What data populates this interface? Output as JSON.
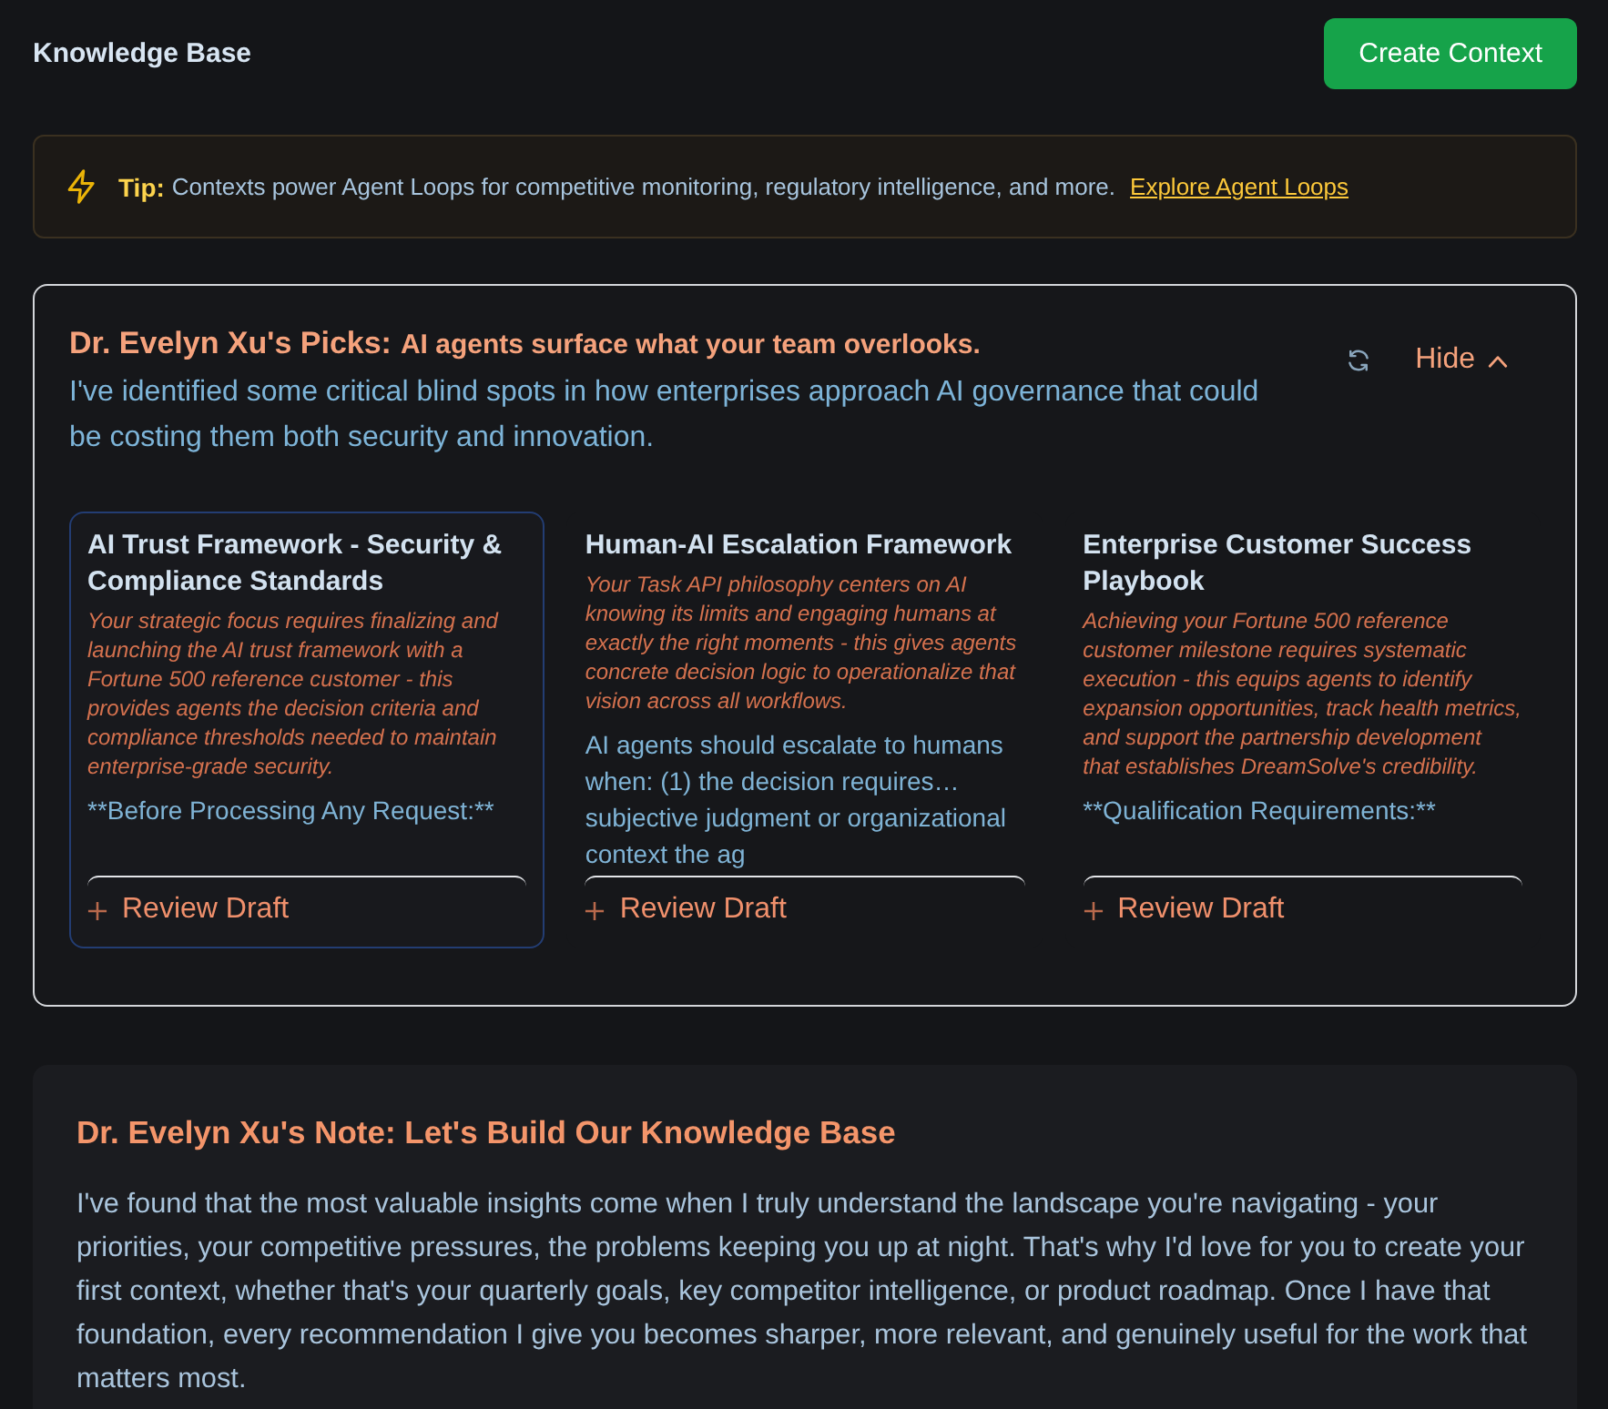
{
  "header": {
    "title": "Knowledge Base",
    "action": "Create Context"
  },
  "tip": {
    "label": "Tip:",
    "text": "Contexts power Agent Loops for competitive monitoring, regulatory intelligence, and more.",
    "link": "Explore Agent Loops"
  },
  "picks": {
    "title": "Dr. Evelyn Xu's Picks:",
    "subtitle": "AI agents surface what your team overlooks.",
    "description": "I've identified some critical blind spots in how enterprises approach AI governance that could be costing them both security and innovation.",
    "hide_label": "Hide",
    "expanded": true,
    "cards": [
      {
        "title": "AI Trust Framework - Security & Compliance Standards",
        "rationale": "Your strategic focus requires finalizing and launching the AI trust framework with a Fortune 500 reference customer - this provides agents the decision criteria and compliance thresholds needed to maintain enterprise-grade security.",
        "excerpt": "**Before Processing Any Request:**",
        "action": "Review Draft",
        "selected": true
      },
      {
        "title": "Human-AI Escalation Framework",
        "rationale": "Your Task API philosophy centers on AI knowing its limits and engaging humans at exactly the right moments - this gives agents concrete decision logic to operationalize that vision across all workflows.",
        "excerpt": "AI agents should escalate to humans when: (1) the decision requires… subjective judgment or organizational context the ag",
        "action": "Review Draft",
        "selected": false
      },
      {
        "title": "Enterprise Customer Success Playbook",
        "rationale": "Achieving your Fortune 500 reference customer milestone requires systematic execution - this equips agents to identify expansion opportunities, track health metrics, and support the partnership development that establishes DreamSolve's credibility.",
        "excerpt": "**Qualification Requirements:**",
        "action": "Review Draft",
        "selected": false
      }
    ]
  },
  "note": {
    "title": "Dr. Evelyn Xu's Note: Let's Build Our Knowledge Base",
    "body": "I've found that the most valuable insights come when I truly understand the landscape you're navigating - your priorities, your competitive pressures, the problems keeping you up at night. That's why I'd love for you to create your first context, whether that's your quarterly goals, key competitor intelligence, or product roadmap. Once I have that foundation, every recommendation I give you becomes sharper, more relevant, and genuinely useful for the work that matters most."
  }
}
